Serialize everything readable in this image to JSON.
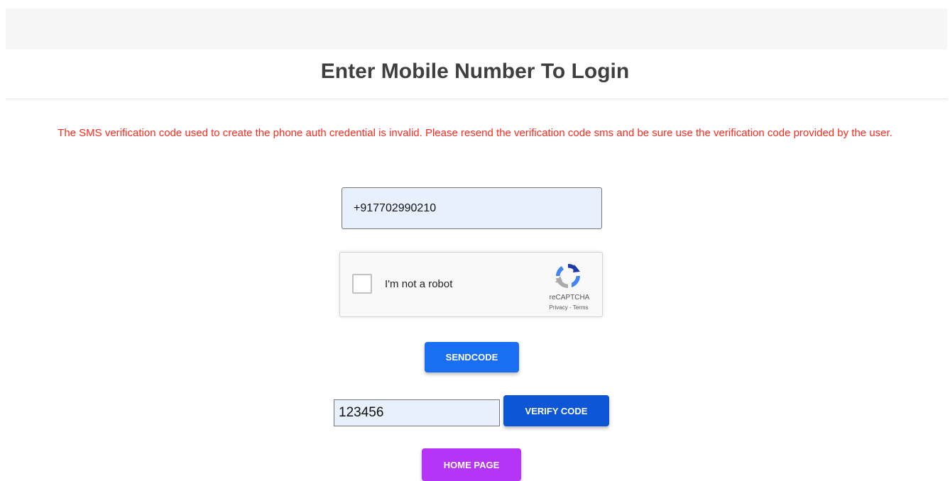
{
  "page": {
    "title": "Enter Mobile Number To Login",
    "error_message": "The SMS verification code used to create the phone auth credential is invalid. Please resend the verification code sms and be sure use the verification code provided by the user."
  },
  "phone": {
    "value": "+917702990210"
  },
  "recaptcha": {
    "label": "I'm not a robot",
    "brand": "reCAPTCHA",
    "links": "Privacy - Terms",
    "icon": "recaptcha-logo-icon"
  },
  "buttons": {
    "send": "SENDCODE",
    "verify": "VERIFY CODE",
    "home": "HOME PAGE"
  },
  "code": {
    "value": "123456"
  },
  "colors": {
    "error": "#ff2a1f",
    "send": "#1a6ef2",
    "verify": "#0d56d6",
    "home": "#b535f6",
    "input_bg": "#e8f0fe"
  }
}
